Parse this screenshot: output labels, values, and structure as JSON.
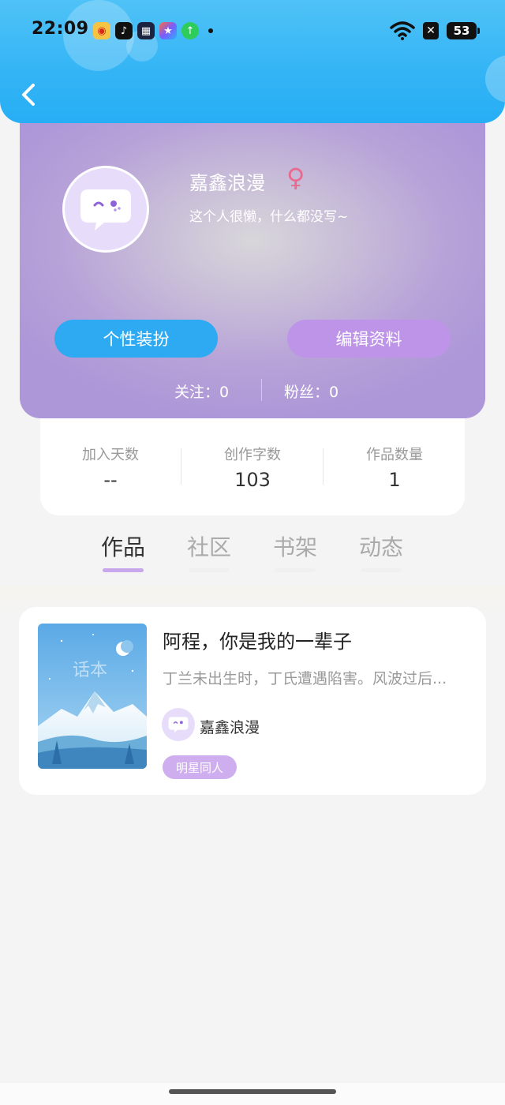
{
  "status_bar": {
    "time": "22:09",
    "battery": "53",
    "app_icons": [
      "weibo-icon",
      "tiktok-icon",
      "calendar-icon",
      "star-app-icon",
      "upload-app-icon"
    ]
  },
  "header": {
    "back_icon": "chevron-left-icon"
  },
  "profile": {
    "username": "嘉鑫浪漫",
    "gender_symbol": "♀",
    "bio": "这个人很懒，什么都没写~",
    "buttons": {
      "style": "个性装扮",
      "edit": "编辑资料"
    },
    "follow": "关注：0",
    "fans": "粉丝：0"
  },
  "stats": [
    {
      "label": "加入天数",
      "value": "--"
    },
    {
      "label": "创作字数",
      "value": "103"
    },
    {
      "label": "作品数量",
      "value": "1"
    }
  ],
  "tabs": [
    {
      "label": "作品",
      "active": true
    },
    {
      "label": "社区",
      "active": false
    },
    {
      "label": "书架",
      "active": false
    },
    {
      "label": "动态",
      "active": false
    }
  ],
  "works": [
    {
      "cover_text": "话本",
      "title": "阿程，你是我的一辈子",
      "description": "丁兰未出生时，丁氏遭遇陷害。风波过后...",
      "author": "嘉鑫浪漫",
      "tag": "明星同人"
    }
  ],
  "colors": {
    "header_blue": "#33b4f5",
    "accent_purple": "#be94e8",
    "button_blue": "#2eaaf2"
  }
}
